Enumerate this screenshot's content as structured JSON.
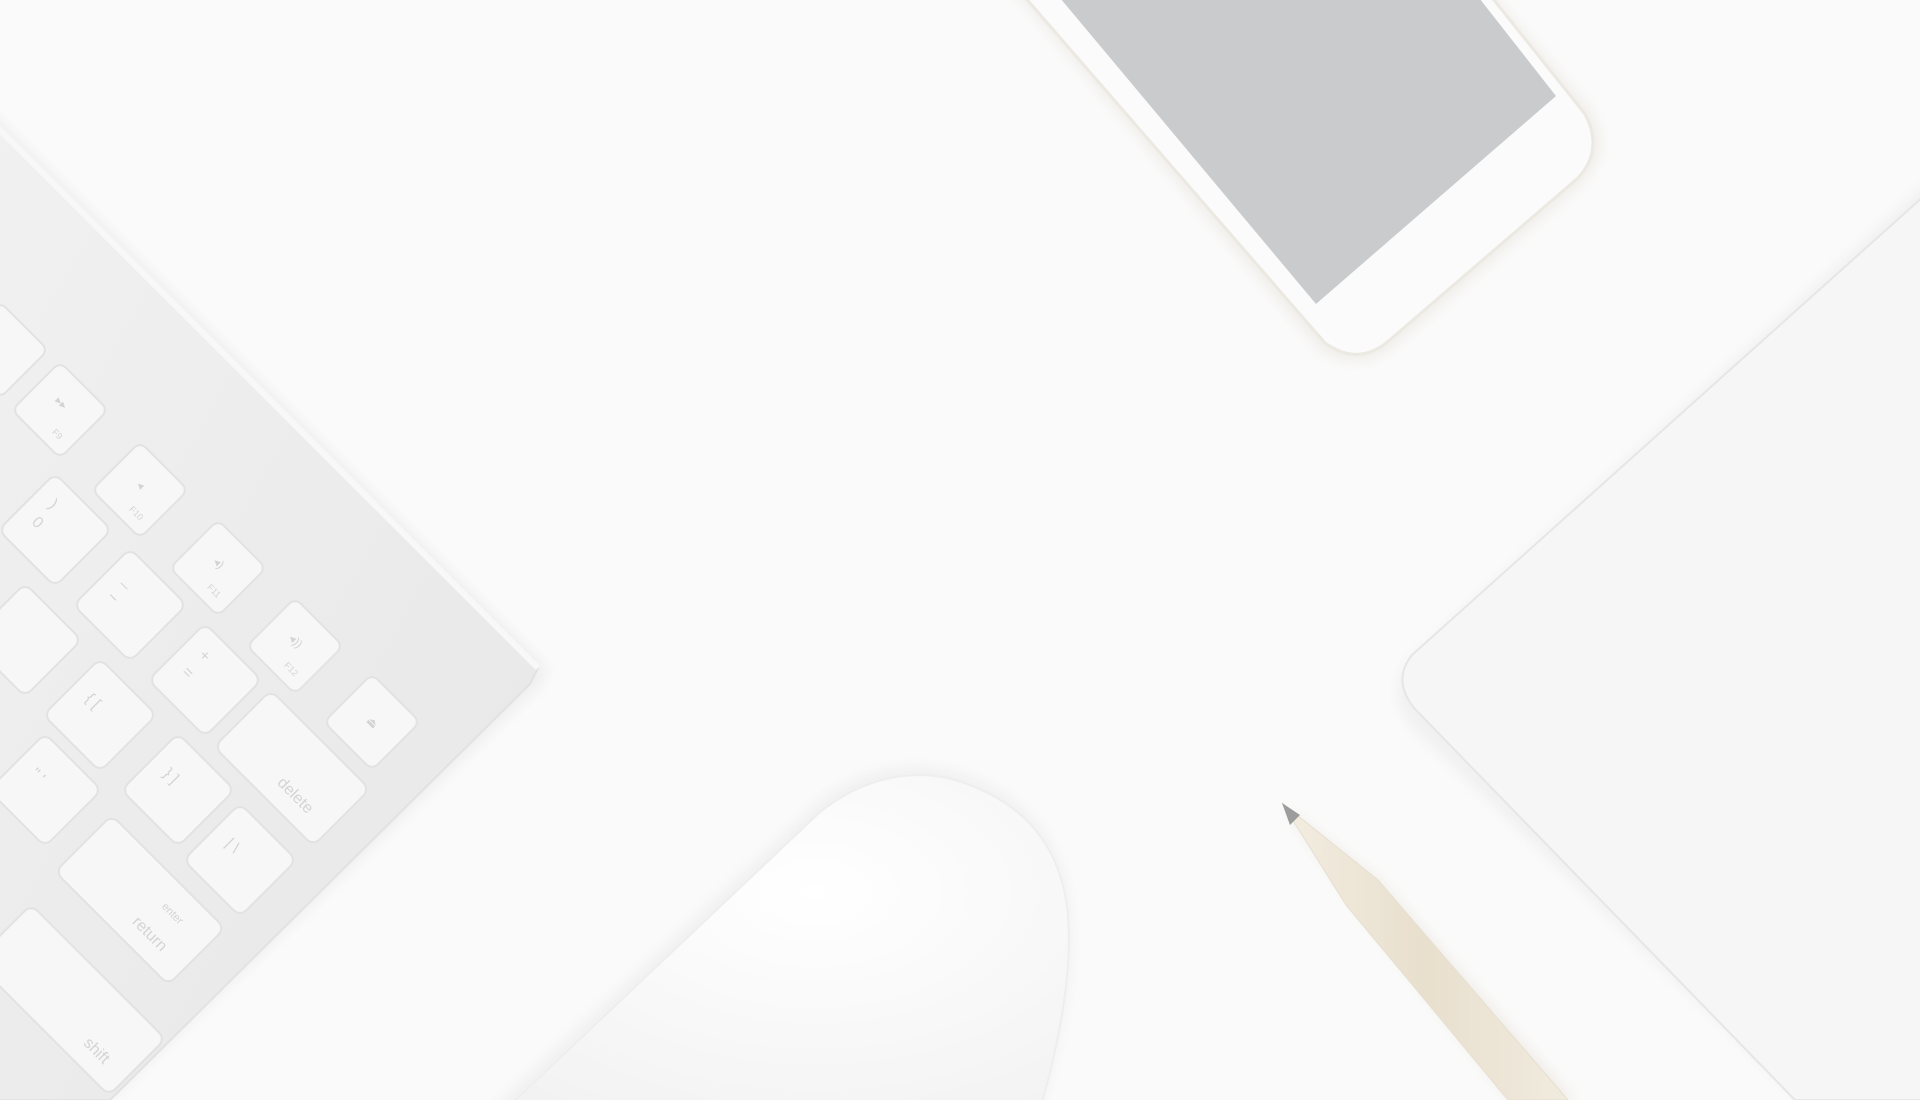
{
  "scene": {
    "colors": {
      "background": "#fafafa",
      "keyboard_body": "#ececec",
      "key": "#f7f7f7",
      "key_stroke": "#e2e2e2",
      "phone_body": "#fbfbfb",
      "phone_screen": "#cacbcc",
      "tablet": "#f6f6f6",
      "mouse": "#f8f8f8",
      "pencil_wood": "#ede6d8",
      "key_label": "#d4d4d4"
    },
    "keyboard": {
      "icon": "keyboard-icon",
      "keys": {
        "f9": "F9",
        "f10": "F10",
        "f11": "F11",
        "f12": "F12",
        "delete": "delete",
        "enter": "enter",
        "return": "return",
        "shift": "shift",
        "minus": "−",
        "underscore": "_",
        "plus": "+",
        "equals": "=",
        "zero": "0",
        "close_paren": ")"
      }
    },
    "phone": {
      "icon": "smartphone-icon"
    },
    "tablet": {
      "icon": "tablet-icon"
    },
    "mouse": {
      "icon": "mouse-icon"
    },
    "pencil": {
      "icon": "pencil-icon"
    }
  }
}
